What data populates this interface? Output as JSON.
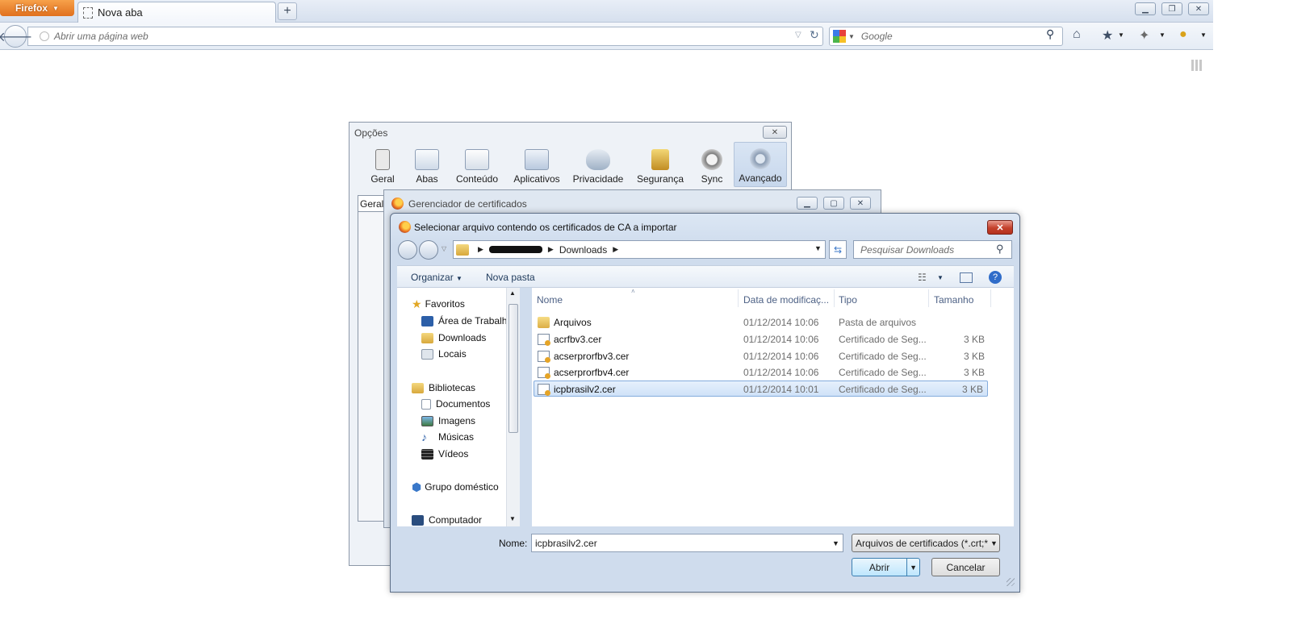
{
  "browser": {
    "menu_button": "Firefox",
    "tab_title": "Nova aba",
    "new_tab_symbol": "+",
    "url_placeholder": "Abrir uma página web",
    "search_placeholder": "Google"
  },
  "options_window": {
    "title": "Opções",
    "panes": [
      "Geral",
      "Abas",
      "Conteúdo",
      "Aplicativos",
      "Privacidade",
      "Segurança",
      "Sync",
      "Avançado"
    ],
    "active_pane": "Avançado",
    "inner_tab": "Geral"
  },
  "cert_manager": {
    "title": "Gerenciador de certificados"
  },
  "file_dialog": {
    "title": "Selecionar arquivo contendo os certificados de CA a importar",
    "breadcrumb_current": "Downloads",
    "search_placeholder": "Pesquisar Downloads",
    "toolbar": {
      "organize": "Organizar",
      "new_folder": "Nova pasta"
    },
    "nav": {
      "favorites": "Favoritos",
      "desktop": "Área de Trabalho",
      "downloads": "Downloads",
      "places": "Locais",
      "libraries": "Bibliotecas",
      "documents": "Documentos",
      "images": "Imagens",
      "music": "Músicas",
      "videos": "Vídeos",
      "homegroup": "Grupo doméstico",
      "computer": "Computador"
    },
    "columns": {
      "name": "Nome",
      "date": "Data de modificaç...",
      "type": "Tipo",
      "size": "Tamanho"
    },
    "files": [
      {
        "name": "Arquivos",
        "date": "01/12/2014 10:06",
        "type": "Pasta de arquivos",
        "size": ""
      },
      {
        "name": "acrfbv3.cer",
        "date": "01/12/2014 10:06",
        "type": "Certificado de Seg...",
        "size": "3 KB"
      },
      {
        "name": "acserprorfbv3.cer",
        "date": "01/12/2014 10:06",
        "type": "Certificado de Seg...",
        "size": "3 KB"
      },
      {
        "name": "acserprorfbv4.cer",
        "date": "01/12/2014 10:06",
        "type": "Certificado de Seg...",
        "size": "3 KB"
      },
      {
        "name": "icpbrasilv2.cer",
        "date": "01/12/2014 10:01",
        "type": "Certificado de Seg...",
        "size": "3 KB"
      }
    ],
    "selected_file": "icpbrasilv2.cer",
    "filename_label": "Nome:",
    "filename_value": "icpbrasilv2.cer",
    "filetype_value": "Arquivos de certificados (*.crt;*",
    "open_button": "Abrir",
    "cancel_button": "Cancelar"
  },
  "colors": {
    "firefox_orange": "#e0701e",
    "selection_blue": "#cfe2f8",
    "close_red": "#c4412c"
  }
}
